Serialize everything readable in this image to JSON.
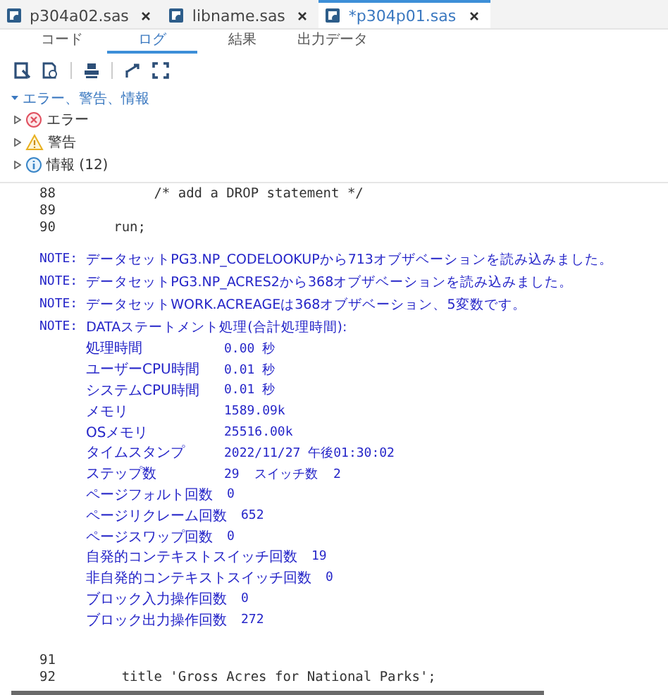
{
  "file_tabs": [
    {
      "label": "p304a02.sas",
      "selected": false
    },
    {
      "label": "libname.sas",
      "selected": false
    },
    {
      "label": "*p304p01.sas",
      "selected": true
    }
  ],
  "view_tabs": [
    {
      "label": "コード",
      "selected": false
    },
    {
      "label": "ログ",
      "selected": true
    },
    {
      "label": "結果",
      "selected": false
    },
    {
      "label": "出力データ",
      "selected": false
    }
  ],
  "tree": {
    "label": "エラー、警告、情報",
    "expanded": true,
    "children": [
      {
        "kind": "error",
        "label": "エラー",
        "expanded": false
      },
      {
        "kind": "warning",
        "label": "警告",
        "expanded": false
      },
      {
        "kind": "info",
        "label": "情報 (12)",
        "expanded": false
      }
    ]
  },
  "log": [
    {
      "kind": "code",
      "number": "88",
      "text": "          /* add a DROP statement */"
    },
    {
      "kind": "code",
      "number": "89"
    },
    {
      "kind": "code",
      "number": "90",
      "text": "     run;"
    },
    {
      "kind": "gap"
    },
    {
      "kind": "note",
      "prefix": "NOTE:",
      "text": "データセットPG3.NP_CODELOOKUPから713オブザベーションを読み込みました。"
    },
    {
      "kind": "note",
      "prefix": "NOTE:",
      "text": "データセットPG3.NP_ACRES2から368オブザベーションを読み込みました。"
    },
    {
      "kind": "note",
      "prefix": "NOTE:",
      "text": "データセットWORK.ACREAGEは368オブザベーション、5変数です。"
    },
    {
      "kind": "note",
      "prefix": "NOTE:",
      "text": "DATAステートメント処理(合計処理時間):"
    },
    {
      "kind": "stat",
      "label": "処理時間",
      "value": "0.00 秒"
    },
    {
      "kind": "stat",
      "label": "ユーザーCPU時間",
      "value": "0.01 秒"
    },
    {
      "kind": "stat",
      "label": "システムCPU時間",
      "value": "0.01 秒"
    },
    {
      "kind": "stat",
      "label": "メモリ",
      "value": "1589.09k"
    },
    {
      "kind": "stat",
      "label": "OSメモリ",
      "value": "25516.00k"
    },
    {
      "kind": "stat",
      "label": "タイムスタンプ",
      "value": "2022/11/27 午後01:30:02"
    },
    {
      "kind": "stat",
      "label": "ステップ数",
      "value": "29  スイッチ数  2"
    },
    {
      "kind": "stat",
      "label": "ページフォルト回数",
      "value": "0"
    },
    {
      "kind": "stat",
      "label": "ページリクレーム回数",
      "value": "652"
    },
    {
      "kind": "stat",
      "label": "ページスワップ回数",
      "value": "0"
    },
    {
      "kind": "stat",
      "label": "自発的コンテキストスイッチ回数",
      "value": "19"
    },
    {
      "kind": "stat",
      "label": "非自発的コンテキストスイッチ回数",
      "value": "0"
    },
    {
      "kind": "stat",
      "label": "ブロック入力操作回数",
      "value": "0"
    },
    {
      "kind": "stat",
      "label": "ブロック出力操作回数",
      "value": "272"
    },
    {
      "kind": "gap"
    },
    {
      "kind": "gap"
    },
    {
      "kind": "code",
      "number": "91"
    },
    {
      "kind": "code",
      "number": "92",
      "text": "      title 'Gross Acres for National Parks';"
    }
  ]
}
